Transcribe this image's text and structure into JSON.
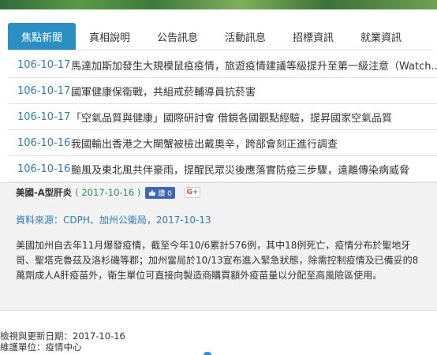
{
  "tabs": [
    {
      "label": "焦點新聞",
      "active": true
    },
    {
      "label": "真相說明",
      "active": false
    },
    {
      "label": "公告訊息",
      "active": false
    },
    {
      "label": "活動訊息",
      "active": false
    },
    {
      "label": "招標資訊",
      "active": false
    },
    {
      "label": "就業資訊",
      "active": false
    }
  ],
  "news": [
    {
      "date": "106-10-17",
      "title": "馬達加斯加發生大規模鼠疫疫情，旅遊疫情建議等級提升至第一級注意（Watch..."
    },
    {
      "date": "106-10-17",
      "title": "國軍健康保衛戰，共組戒菸輔導員抗菸害"
    },
    {
      "date": "106-10-17",
      "title": "「空氣品質與健康」國際研討會 借鏡各國觀點經驗，提昇國家空氣品質"
    },
    {
      "date": "106-10-16",
      "title": "我國輸出香港之大閘蟹被檢出戴奧辛，跨部會刻正進行調查"
    },
    {
      "date": "106-10-16",
      "title": "颱風及東北風共伴豪雨，提醒民眾災後應落實防疫三步驟，遠離傳染病威脅"
    }
  ],
  "detail": {
    "title": "美國-A型肝炎",
    "date": "( 2017-10-16 )",
    "like_label": "讚 0",
    "gplus_label": "G+",
    "source": "資料來源：CDPH、加州公衛局，2017-10-13",
    "body": "美國加州自去年11月爆發疫情，截至今年10/6累計576例，其中18例死亡，疫情分布於聖地牙哥、聖塔克魯茲及洛杉磯等郡；加州當局於10/13宣布進入緊急狀態，除需控制疫情及已備妥的8萬劑成人A肝疫苗外，衛生單位可直接向製造商購買額外疫苗量以分配至高風險區使用。"
  },
  "footer": {
    "updated": "檢視與更新日期：2017-10-16",
    "maintainer": "維護單位：疫情中心"
  }
}
